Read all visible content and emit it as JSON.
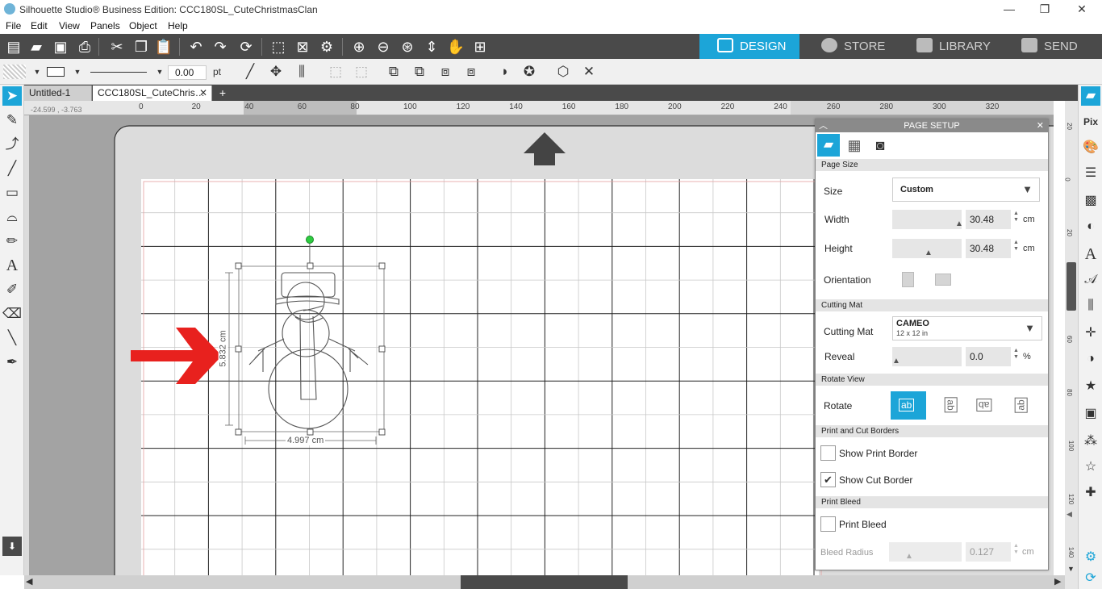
{
  "window": {
    "title": "Silhouette Studio® Business Edition: CCC180SL_CuteChristmasClan",
    "minimize": "—",
    "restore": "❐",
    "close": "✕"
  },
  "menu": [
    "File",
    "Edit",
    "View",
    "Panels",
    "Object",
    "Help"
  ],
  "modes": {
    "design": "DESIGN",
    "store": "STORE",
    "library": "LIBRARY",
    "send": "SEND"
  },
  "toolbar2": {
    "line_width": "0.00",
    "line_unit": "pt"
  },
  "doc_tabs": [
    {
      "label": "Untitled-1",
      "close": "✕"
    },
    {
      "label": "CCC180SL_CuteChris…",
      "close": "✕"
    }
  ],
  "add_tab": "+",
  "coords": "-24.599 , -3.763",
  "ruler_ticks": [
    "0",
    "20",
    "40",
    "60",
    "80",
    "100",
    "120",
    "140",
    "160",
    "180",
    "200",
    "220",
    "240",
    "260",
    "280",
    "300",
    "320"
  ],
  "vruler_ticks": [
    "20",
    "0",
    "20",
    "40",
    "60",
    "80",
    "100",
    "120",
    "140"
  ],
  "canvas": {
    "width_dim": "4.997 cm",
    "height_dim": "5.832 cm"
  },
  "page_setup": {
    "title": "PAGE SETUP",
    "page_size_section": "Page Size",
    "size_label": "Size",
    "size_value": "Custom",
    "width_label": "Width",
    "width_value": "30.48",
    "height_label": "Height",
    "height_value": "30.48",
    "unit": "cm",
    "orientation_label": "Orientation",
    "cutting_mat_section": "Cutting Mat",
    "cutting_mat_label": "Cutting Mat",
    "cutting_mat_value": "CAMEO",
    "cutting_mat_sub": "12 x 12 in",
    "reveal_label": "Reveal",
    "reveal_value": "0.0",
    "reveal_unit": "%",
    "rotate_view_section": "Rotate View",
    "rotate_label": "Rotate",
    "rotate_options": [
      "ab",
      "ab",
      "ab",
      "ab"
    ],
    "borders_section": "Print and Cut Borders",
    "show_print_border": "Show Print Border",
    "show_cut_border": "Show Cut Border",
    "show_print_border_checked": false,
    "show_cut_border_checked": true,
    "bleed_section": "Print Bleed",
    "print_bleed": "Print Bleed",
    "print_bleed_checked": false,
    "bleed_radius_label": "Bleed Radius",
    "bleed_radius_value": "0.127",
    "bleed_unit": "cm"
  },
  "colors": {
    "accent": "#1ca5d8",
    "dark_toolbar": "#4a4a4a",
    "canvas_bg": "#a3a3a3",
    "arrow": "#e8211e",
    "selection_handle": "#2ecc40"
  }
}
